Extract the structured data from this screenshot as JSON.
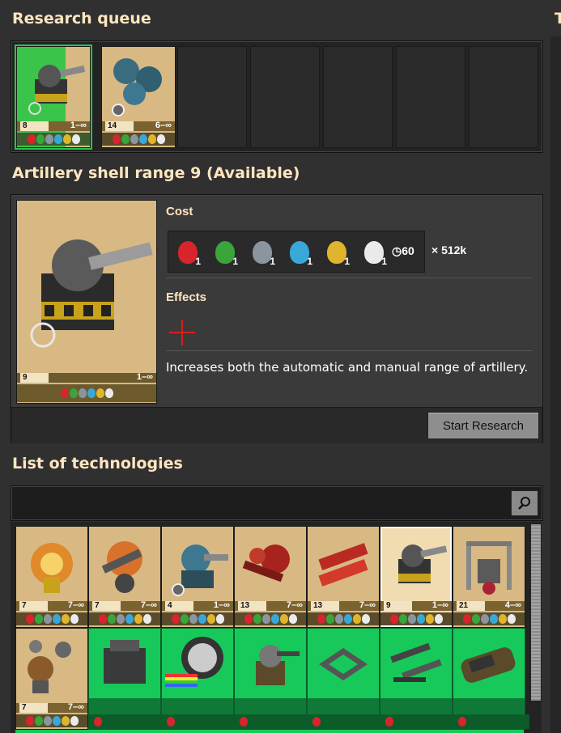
{
  "queue": {
    "title": "Research queue",
    "items": [
      {
        "level": "8",
        "range": "1–∞"
      },
      {
        "level": "14",
        "range": "6–∞"
      }
    ]
  },
  "selected": {
    "title": "Artillery shell range 9 (Available)",
    "card": {
      "level": "9",
      "range": "1–∞"
    },
    "cost": {
      "label": "Cost",
      "packs": [
        {
          "color": "red",
          "count": "1"
        },
        {
          "color": "green",
          "count": "1"
        },
        {
          "color": "gray",
          "count": "1"
        },
        {
          "color": "blue",
          "count": "1"
        },
        {
          "color": "yellow",
          "count": "1"
        },
        {
          "color": "white",
          "count": "1"
        }
      ],
      "time": "60",
      "multiplier": "× 512k"
    },
    "effects_label": "Effects",
    "description": "Increases both the automatic and manual range of artillery.",
    "start_button": "Start Research"
  },
  "list": {
    "title": "List of technologies",
    "row1": [
      {
        "level": "7",
        "range": "7–∞"
      },
      {
        "level": "7",
        "range": "7–∞"
      },
      {
        "level": "4",
        "range": "1–∞"
      },
      {
        "level": "13",
        "range": "7–∞"
      },
      {
        "level": "13",
        "range": "7–∞"
      },
      {
        "level": "9",
        "range": "1–∞"
      },
      {
        "level": "21",
        "range": "4–∞"
      }
    ],
    "row2_first": {
      "level": "7",
      "range": "7–∞"
    }
  },
  "right_edge_letter": "T",
  "colors": {
    "accent_green": "#17c95a",
    "panel": "#242324",
    "card": "#d8b984"
  }
}
